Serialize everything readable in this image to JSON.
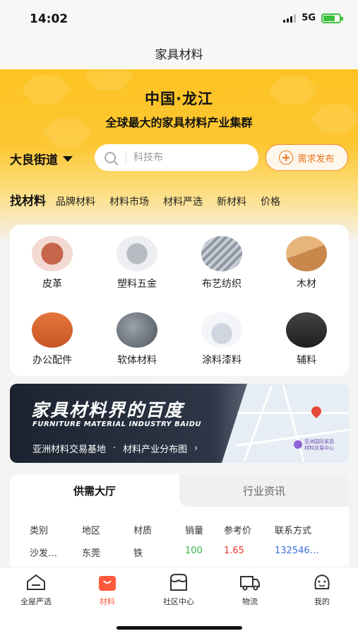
{
  "status_bar": {
    "time": "14:02",
    "network": "5G"
  },
  "nav": {
    "title": "家具材料"
  },
  "hero": {
    "title": "中国·龙江",
    "subtitle": "全球最大的家具材料产业集群",
    "location": "大良街道",
    "search_placeholder": "科技布",
    "publish_label": "需求发布"
  },
  "tabs": {
    "main": "找材料",
    "items": [
      "品牌材料",
      "材料市场",
      "材料严选",
      "新材料",
      "价格"
    ]
  },
  "categories": [
    {
      "label": "皮革",
      "color": "#b3563a"
    },
    {
      "label": "塑料五金",
      "color": "#cfd2d6"
    },
    {
      "label": "布艺纺织",
      "color": "#9aa2ad"
    },
    {
      "label": "木材",
      "color": "#d39a5d"
    },
    {
      "label": "办公配件",
      "color": "#d9652e"
    },
    {
      "label": "软体材料",
      "color": "#6f7780"
    },
    {
      "label": "涂料漆料",
      "color": "#e6eaf0"
    },
    {
      "label": "辅料",
      "color": "#2d2d2d"
    }
  ],
  "banner": {
    "title": "家具材料界的百度",
    "subtitle_en": "FURNITURE MATERIAL INDUSTRY BAIDU",
    "link_left": "亚洲材料交易基地",
    "link_sep": "·",
    "link_right": "材料产业分布图",
    "link_arrow": "›",
    "map_label_1": "亚洲国际家具",
    "map_label_2": "材料交易中心"
  },
  "feed": {
    "tabs": [
      "供需大厅",
      "行业资讯"
    ],
    "columns": [
      "类别",
      "地区",
      "材质",
      "销量",
      "参考价",
      "联系方式"
    ],
    "rows": [
      {
        "category": "沙发…",
        "region": "东莞",
        "material": "铁",
        "sales": "100",
        "price": "1.65",
        "contact": "132546…"
      }
    ],
    "colors": {
      "sales": "#3bb54a",
      "price": "#e8352e",
      "contact": "#3a6fd8"
    }
  },
  "bottom_nav": {
    "items": [
      "全屋严选",
      "材料",
      "社区中心",
      "物流",
      "我的"
    ],
    "active_index": 1,
    "accent": "#ff5a3c"
  }
}
